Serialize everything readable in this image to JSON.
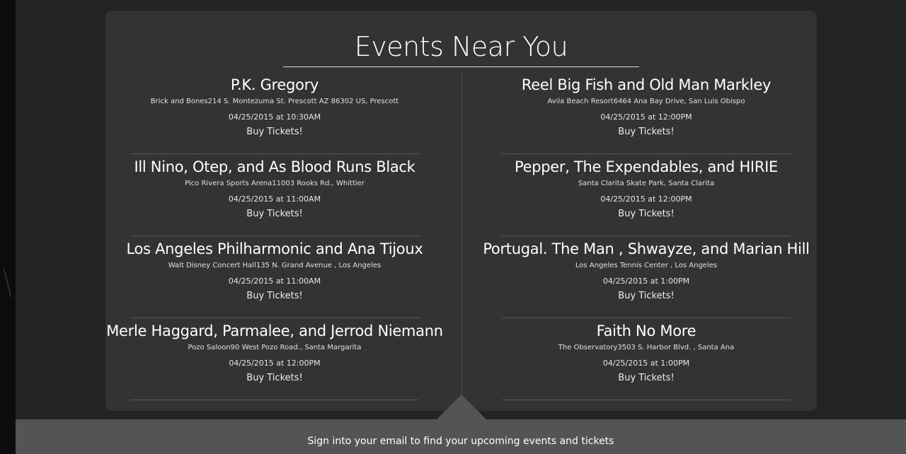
{
  "header": {
    "title": "Events Near You"
  },
  "events_left": [
    {
      "name": "P.K. Gregory",
      "venue": "Brick and Bones214 S. Montezuma St. Prescott AZ 86302 US, Prescott",
      "date": "04/25/2015 at 10:30AM",
      "buy_label": "Buy Tickets!"
    },
    {
      "name": "Ill Nino, Otep, and As Blood Runs Black",
      "venue": "Pico Rivera Sports Arena11003 Rooks Rd., Whittier",
      "date": "04/25/2015 at 11:00AM",
      "buy_label": "Buy Tickets!"
    },
    {
      "name": "Los Angeles Philharmonic and Ana Tijoux",
      "venue": "Walt Disney Concert Hall135 N. Grand Avenue , Los Angeles",
      "date": "04/25/2015 at 11:00AM",
      "buy_label": "Buy Tickets!"
    },
    {
      "name": "Merle Haggard, Parmalee, and Jerrod Niemann",
      "venue": "Pozo Saloon90 West Pozo Road., Santa Margarita",
      "date": "04/25/2015 at 12:00PM",
      "buy_label": "Buy Tickets!"
    }
  ],
  "events_right": [
    {
      "name": "Reel Big Fish and Old Man Markley",
      "venue": "Avila Beach Resort6464 Ana Bay Drive, San Luis Obispo",
      "date": "04/25/2015 at 12:00PM",
      "buy_label": "Buy Tickets!"
    },
    {
      "name": "Pepper, The Expendables, and HIRIE",
      "venue": "Santa Clarita Skate Park, Santa Clarita",
      "date": "04/25/2015 at 12:00PM",
      "buy_label": "Buy Tickets!"
    },
    {
      "name": "Portugal. The Man , Shwayze, and Marian Hill",
      "venue": "Los Angeles Tennis Center , Los Angeles",
      "date": "04/25/2015 at 1:00PM",
      "buy_label": "Buy Tickets!"
    },
    {
      "name": "Faith No More",
      "venue": "The Observatory3503 S. Harbor Blvd. , Santa Ana",
      "date": "04/25/2015 at 1:00PM",
      "buy_label": "Buy Tickets!"
    }
  ],
  "footer": {
    "signin_text": "Sign into your email to find your upcoming events and tickets"
  },
  "colors": {
    "page_background": "#232323",
    "panel_background": "#333333",
    "footer_background": "#545454",
    "text": "#ffffff"
  }
}
